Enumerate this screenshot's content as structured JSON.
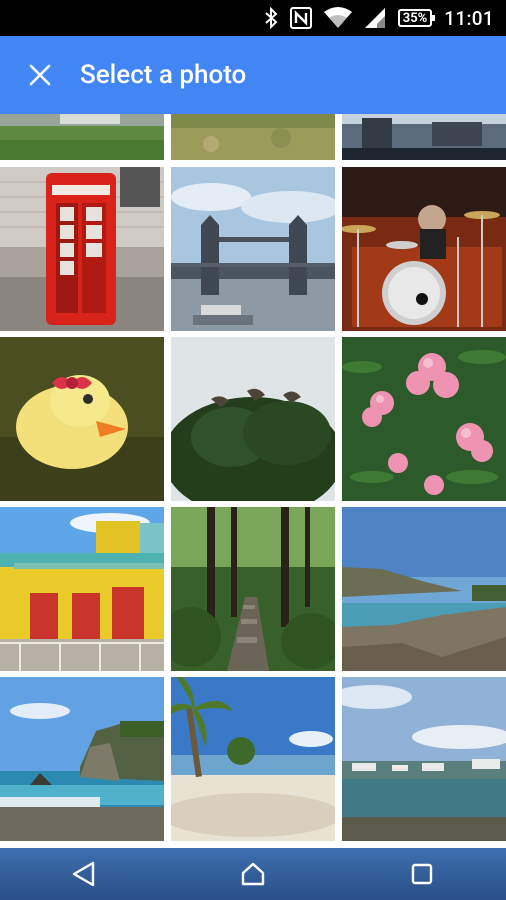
{
  "status_bar": {
    "icons": [
      "bluetooth-icon",
      "nfc-icon",
      "wifi-icon",
      "cell-signal-icon",
      "battery-icon"
    ],
    "battery": "35%",
    "time": "11:01"
  },
  "app_bar": {
    "title": "Select a photo",
    "close_icon": "close-icon",
    "color": "#4285f4"
  },
  "photos": [
    "grass-lawn-photo",
    "grass-field-photo",
    "city-lake-photo",
    "red-phone-booth-photo",
    "tower-bridge-photo",
    "drummer-concert-photo",
    "rubber-duck-photo",
    "tree-with-birds-photo",
    "pink-flowers-photo",
    "yellow-house-photo",
    "forest-path-photo",
    "coastal-cliffs-photo",
    "rocky-sea-coast-photo",
    "palm-beach-photo",
    "harbor-boats-photo"
  ],
  "nav_bar": {
    "icons": [
      "back-icon",
      "home-icon",
      "recents-icon"
    ]
  }
}
